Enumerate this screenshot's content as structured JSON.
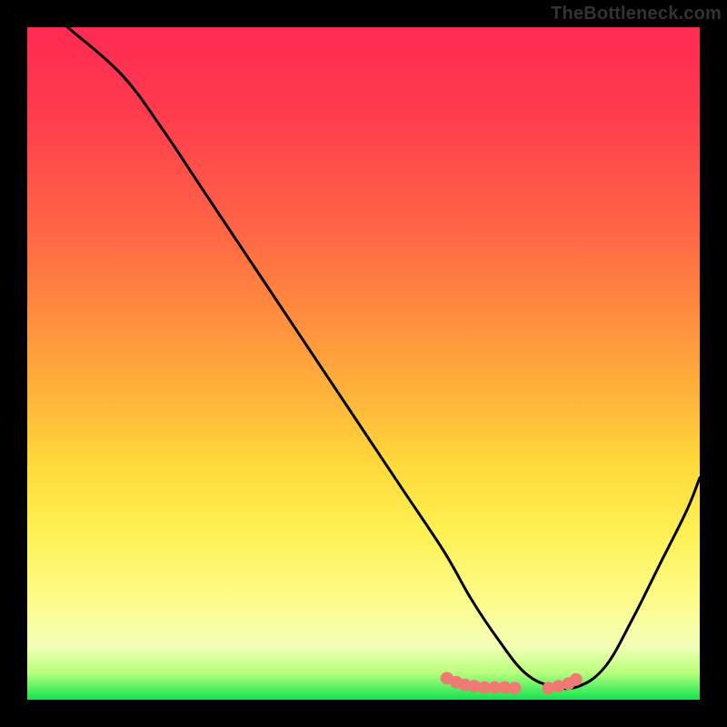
{
  "watermark": "TheBottleneck.com",
  "chart_data": {
    "type": "line",
    "title": "",
    "xlabel": "",
    "ylabel": "",
    "xlim": [
      0,
      100
    ],
    "ylim": [
      0,
      100
    ],
    "grid": false,
    "legend": false,
    "note": "Axes unlabeled; values below are percentage coordinates estimated from pixel positions (0 = left/bottom, 100 = right/top).",
    "series": [
      {
        "name": "curve",
        "color": "#000000",
        "x": [
          6,
          14,
          20,
          26,
          32,
          38,
          44,
          50,
          56,
          62,
          66,
          70,
          74,
          78,
          82,
          86,
          90,
          94,
          98,
          100
        ],
        "y": [
          100,
          93,
          85,
          76,
          67,
          58,
          49,
          40,
          31,
          22,
          15,
          9,
          4,
          2,
          2,
          5,
          12,
          20,
          28,
          33
        ]
      }
    ],
    "scatter": {
      "name": "bottom-markers",
      "color": "#ef7a72",
      "x": [
        62.4,
        63.8,
        65.1,
        66.5,
        68,
        69.5,
        71,
        72.5,
        77.5,
        79,
        80.5,
        81.6
      ],
      "y": [
        3.2,
        2.6,
        2.2,
        2.0,
        1.8,
        1.8,
        1.8,
        1.7,
        1.7,
        2.0,
        2.4,
        3.0
      ]
    },
    "background_gradient": {
      "orientation": "vertical",
      "stops": [
        {
          "pos_pct": 0,
          "color": "#ff2a53"
        },
        {
          "pos_pct": 12,
          "color": "#ff3a4e"
        },
        {
          "pos_pct": 30,
          "color": "#ff6545"
        },
        {
          "pos_pct": 42,
          "color": "#ff8a3f"
        },
        {
          "pos_pct": 55,
          "color": "#ffb43a"
        },
        {
          "pos_pct": 65,
          "color": "#ffd93a"
        },
        {
          "pos_pct": 75,
          "color": "#fff153"
        },
        {
          "pos_pct": 85,
          "color": "#fdfc8a"
        },
        {
          "pos_pct": 92,
          "color": "#f3ffb6"
        },
        {
          "pos_pct": 96,
          "color": "#b8ff7d"
        },
        {
          "pos_pct": 100,
          "color": "#14e24f"
        }
      ]
    }
  }
}
